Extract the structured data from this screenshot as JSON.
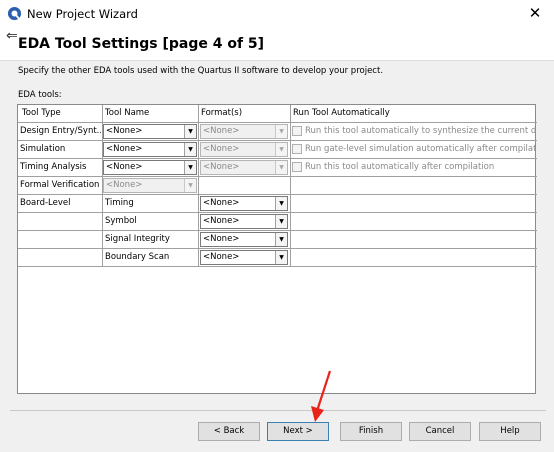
{
  "window": {
    "title": "New Project Wizard",
    "close": "✕",
    "back": "⇐"
  },
  "heading": "EDA Tool Settings [page 4 of 5]",
  "description": "Specify the other EDA tools used with the Quartus II software to develop your project.",
  "section_label": "EDA tools:",
  "table": {
    "headers": [
      "Tool Type",
      "Tool Name",
      "Format(s)",
      "Run Tool Automatically"
    ],
    "rows": [
      {
        "type": "Design Entry/Synt...",
        "name": "<None>",
        "format": "<None>",
        "run": "Run this tool automatically to synthesize the current design"
      },
      {
        "type": "Simulation",
        "name": "<None>",
        "format": "<None>",
        "run": "Run gate-level simulation automatically after compilation"
      },
      {
        "type": "Timing Analysis",
        "name": "<None>",
        "format": "<None>",
        "run": "Run this tool automatically after compilation"
      },
      {
        "type": "Formal Verification",
        "name": "<None>"
      },
      {
        "type": "Board-Level",
        "name": "Timing",
        "format": "<None>"
      },
      {
        "name": "Symbol",
        "format": "<None>"
      },
      {
        "name": "Signal Integrity",
        "format": "<None>"
      },
      {
        "name": "Boundary Scan",
        "format": "<None>"
      }
    ]
  },
  "buttons": {
    "back": "< Back",
    "next": "Next >",
    "finish": "Finish",
    "cancel": "Cancel",
    "help": "Help"
  },
  "colors": {
    "annotation_arrow": "#e8231a",
    "focus_border": "#3c7fb1"
  }
}
